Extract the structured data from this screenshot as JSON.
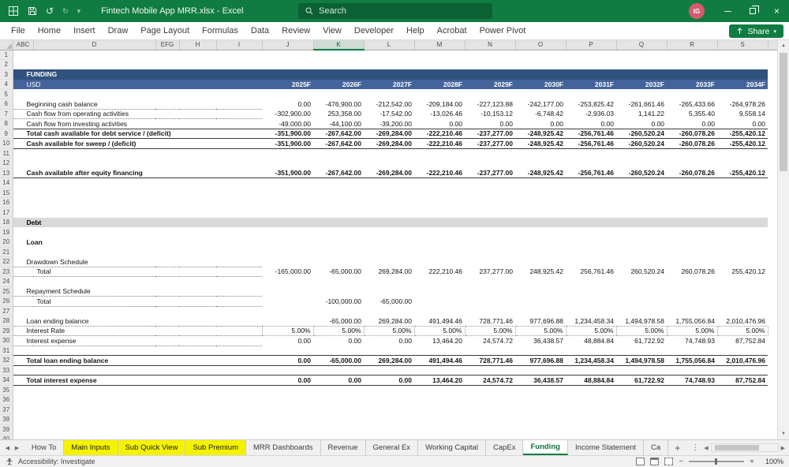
{
  "titlebar": {
    "title": "Fintech Mobile App MRR.xlsx - Excel",
    "search_placeholder": "Search",
    "avatar_initials": "IG"
  },
  "ribbon": {
    "tabs": [
      "File",
      "Home",
      "Insert",
      "Draw",
      "Page Layout",
      "Formulas",
      "Data",
      "Review",
      "View",
      "Developer",
      "Help",
      "Acrobat",
      "Power Pivot"
    ],
    "share_label": "Share"
  },
  "grid": {
    "column_headers": [
      "ABC",
      "D",
      "EFG",
      "H",
      "I",
      "J",
      "K",
      "L",
      "M",
      "N",
      "O",
      "P",
      "Q",
      "R",
      "S"
    ],
    "selected_column": "K",
    "row_count": 40,
    "rows": [
      {
        "n": 3,
        "kind": "band1",
        "label": "FUNDING"
      },
      {
        "n": 4,
        "kind": "band2",
        "label": "USD",
        "values": [
          "2025F",
          "2026F",
          "2027F",
          "2028F",
          "2029F",
          "2030F",
          "2031F",
          "2032F",
          "2033F",
          "2034F"
        ]
      },
      {
        "n": 6,
        "kind": "data",
        "label": "Beginning cash balance",
        "u": true,
        "values": [
          "0.00",
          "-476,900.00",
          "-212,542.00",
          "-209,184.00",
          "-227,123.88",
          "-242,177.00",
          "-253,825.42",
          "-261,661.46",
          "-265,433.66",
          "-264,978.26"
        ]
      },
      {
        "n": 7,
        "kind": "data",
        "label": "Cash flow from operating activities",
        "u": true,
        "values": [
          "-302,900.00",
          "253,358.00",
          "-17,542.00",
          "-13,026.46",
          "-10,153.12",
          "-6,748.42",
          "-2,936.03",
          "1,141.22",
          "5,355.40",
          "9,558.14"
        ]
      },
      {
        "n": 8,
        "kind": "data",
        "label": "Cash flow from investing activities",
        "u": true,
        "values": [
          "-49,000.00",
          "-44,100.00",
          "-39,200.00",
          "0.00",
          "0.00",
          "0.00",
          "0.00",
          "0.00",
          "0.00",
          "0.00"
        ]
      },
      {
        "n": 9,
        "kind": "data",
        "label": "Total cash available for debt service / (deficit)",
        "b": true,
        "bt": true,
        "bb": true,
        "values": [
          "-351,900.00",
          "-267,642.00",
          "-269,284.00",
          "-222,210.46",
          "-237,277.00",
          "-248,925.42",
          "-256,761.46",
          "-260,520.24",
          "-260,078.26",
          "-255,420.12"
        ]
      },
      {
        "n": 10,
        "kind": "data",
        "label": "Cash available for sweep / (deficit)",
        "b": true,
        "bb": true,
        "values": [
          "-351,900.00",
          "-267,642.00",
          "-269,284.00",
          "-222,210.46",
          "-237,277.00",
          "-248,925.42",
          "-256,761.46",
          "-260,520.24",
          "-260,078.26",
          "-255,420.12"
        ]
      },
      {
        "n": 13,
        "kind": "data",
        "label": "Cash available after equity financing",
        "b": true,
        "bb": true,
        "values": [
          "-351,900.00",
          "-267,642.00",
          "-269,284.00",
          "-222,210.46",
          "-237,277.00",
          "-248,925.42",
          "-256,761.46",
          "-260,520.24",
          "-260,078.26",
          "-255,420.12"
        ]
      },
      {
        "n": 18,
        "kind": "section",
        "label": "Debt"
      },
      {
        "n": 20,
        "kind": "label",
        "label": "Loan",
        "b": true
      },
      {
        "n": 22,
        "kind": "label",
        "label": "Drawdown Schedule",
        "u": true
      },
      {
        "n": 23,
        "kind": "data",
        "label": "Total",
        "ind": true,
        "u": true,
        "values": [
          "-165,000.00",
          "-65,000.00",
          "269,284.00",
          "222,210.46",
          "237,277.00",
          "248,925.42",
          "256,761.46",
          "260,520.24",
          "260,078.26",
          "255,420.12"
        ]
      },
      {
        "n": 25,
        "kind": "label",
        "label": "Repayment Schedule",
        "u": true
      },
      {
        "n": 26,
        "kind": "data",
        "label": "Total",
        "ind": true,
        "u": true,
        "values": [
          "",
          "-100,000.00",
          "-65,000.00",
          "",
          "",
          "",
          "",
          "",
          "",
          ""
        ]
      },
      {
        "n": 28,
        "kind": "data",
        "label": "Loan ending balance",
        "u": true,
        "values": [
          "",
          "-65,000.00",
          "269,284.00",
          "491,494.46",
          "728,771.46",
          "977,696.88",
          "1,234,458.34",
          "1,494,978.58",
          "1,755,056.84",
          "2,010,476.96"
        ]
      },
      {
        "n": 29,
        "kind": "data",
        "label": "Interest Rate",
        "u": true,
        "inp": true,
        "values": [
          "5.00%",
          "5.00%",
          "5.00%",
          "5.00%",
          "5.00%",
          "5.00%",
          "5.00%",
          "5.00%",
          "5.00%",
          "5.00%"
        ]
      },
      {
        "n": 30,
        "kind": "data",
        "label": "Interest expense",
        "u": true,
        "values": [
          "0.00",
          "0.00",
          "0.00",
          "13,464.20",
          "24,574.72",
          "36,438.57",
          "48,884.84",
          "61,722.92",
          "74,748.93",
          "87,752.84"
        ]
      },
      {
        "n": 32,
        "kind": "data",
        "label": "Total loan ending balance",
        "b": true,
        "bt": true,
        "bb": true,
        "values": [
          "0.00",
          "-65,000.00",
          "269,284.00",
          "491,494.46",
          "728,771.46",
          "977,696.88",
          "1,234,458.34",
          "1,494,978.58",
          "1,755,056.84",
          "2,010,476.96"
        ]
      },
      {
        "n": 34,
        "kind": "data",
        "label": "Total interest expense",
        "b": true,
        "bt": true,
        "bb": true,
        "values": [
          "0.00",
          "0.00",
          "0.00",
          "13,464.20",
          "24,574.72",
          "36,438.57",
          "48,884.84",
          "61,722.92",
          "74,748.93",
          "87,752.84"
        ]
      }
    ]
  },
  "sheet_tabs": {
    "tabs": [
      {
        "label": "How To",
        "style": "normal"
      },
      {
        "label": "Main Inputs",
        "style": "yellow"
      },
      {
        "label": "Sub Quick View",
        "style": "yellow"
      },
      {
        "label": "Sub Premium",
        "style": "yellow"
      },
      {
        "label": "MRR Dashboards",
        "style": "normal"
      },
      {
        "label": "Revenue",
        "style": "normal"
      },
      {
        "label": "General Ex",
        "style": "normal"
      },
      {
        "label": "Working Capital",
        "style": "normal"
      },
      {
        "label": "CapEx",
        "style": "normal"
      },
      {
        "label": "Funding",
        "style": "active"
      },
      {
        "label": "Income Statement",
        "style": "normal"
      },
      {
        "label": "Ca",
        "style": "normal"
      }
    ]
  },
  "status_bar": {
    "accessibility": "Accessibility: Investigate",
    "zoom": "100%"
  },
  "colors": {
    "titlebar_green": "#107C41",
    "band_dark_blue": "#31517E",
    "band_mid_blue": "#44639B",
    "section_gray": "#D9D9D9",
    "tab_yellow": "#F5F200",
    "accent_green": "#107C41"
  }
}
